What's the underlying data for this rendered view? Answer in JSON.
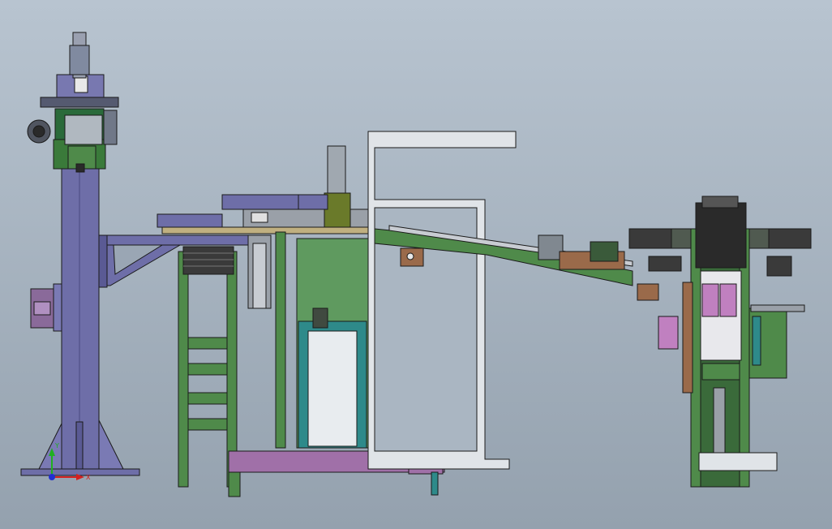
{
  "viewport": {
    "background_top": "#b8c4d0",
    "background_bottom": "#94a1ae"
  },
  "palette": {
    "column_purple": "#6e6ea8",
    "frame_green": "#4f8a4a",
    "panel_green": "#5f9a5f",
    "teal": "#2e8a8a",
    "magenta_base": "#a070a8",
    "silver_frame": "#e0e4e8",
    "dark_block": "#2a2a2a",
    "brown_part": "#9a6a4a",
    "outline": "#1a1a1a"
  },
  "triad": {
    "x_label": "X",
    "y_label": "Y",
    "x_color": "#d42020",
    "y_color": "#20b020",
    "origin_color": "#2030d0"
  }
}
